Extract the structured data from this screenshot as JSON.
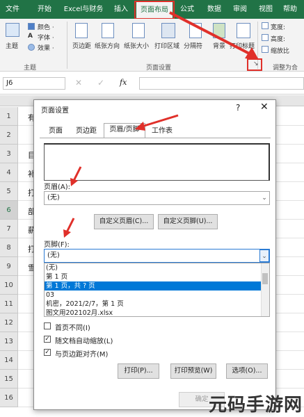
{
  "ribbon_tabs": [
    "文件",
    "开始",
    "Excel与财务",
    "插入",
    "页面布局",
    "公式",
    "数据",
    "审阅",
    "视图",
    "帮助"
  ],
  "ribbon": {
    "theme_label": "主题",
    "colors_label": "颜色 ·",
    "fonts_label": "字体 ·",
    "effects_label": "效果 ·",
    "margins_label": "页边距",
    "orientation_label": "纸张方向",
    "size_label": "纸张大小",
    "print_area_label": "打印区域",
    "breaks_label": "分隔符",
    "background_label": "背景",
    "print_titles_label": "打印标题",
    "width_label": "宽度:",
    "height_label": "高度:",
    "scale_label": "缩放比",
    "group_theme": "主题",
    "group_page_setup": "页面设置",
    "group_scale": "调整为合",
    "launcher_glyph": "↘"
  },
  "formula_bar": {
    "name_box": "J6",
    "fx": "fx"
  },
  "rows": [
    "1",
    "2",
    "3",
    "4",
    "5",
    "6",
    "7",
    "8",
    "9",
    "10",
    "11",
    "12",
    "13",
    "14",
    "15",
    "16"
  ],
  "cell_fragments": [
    "有",
    "目",
    "补",
    "打",
    "部",
    "薪",
    "打",
    "雪"
  ],
  "dialog": {
    "title": "页面设置",
    "help": "?",
    "close": "✕",
    "tabs": [
      "页面",
      "页边距",
      "页眉/页脚",
      "工作表"
    ],
    "header_label": "页眉(A):",
    "header_value": "(无)",
    "custom_header_button": "自定义页眉(C)...",
    "custom_footer_button": "自定义页脚(U)...",
    "footer_label": "页脚(F):",
    "footer_value": "(无)",
    "footer_options": [
      "(无)",
      "第 1 页",
      "第 1 页，共 ? 页",
      "03",
      "机密，2021/2/7，第 1 页",
      "图文用202102月.xlsx"
    ],
    "selected_option_index": 2,
    "checkboxes": [
      {
        "label": "首页不同(I)",
        "checked": false
      },
      {
        "label": "随文档自动缩放(L)",
        "checked": true
      },
      {
        "label": "与页边距对齐(M)",
        "checked": true
      }
    ],
    "print_button": "打印(P)...",
    "print_preview_button": "打印预览(W)",
    "options_button": "选项(O)...",
    "ok_button": "确定"
  },
  "colors": {
    "excel_green": "#217346",
    "highlight_red": "#e0302a",
    "selection_blue": "#0078d7"
  },
  "watermark": "元码手游网"
}
